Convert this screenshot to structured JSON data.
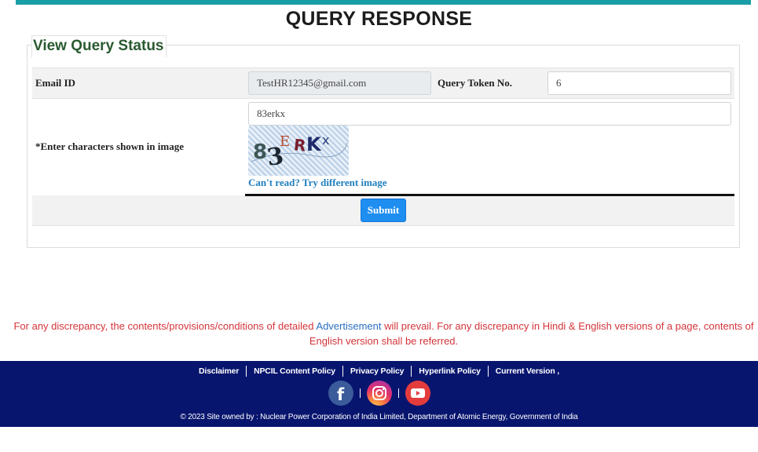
{
  "page": {
    "title": "QUERY RESPONSE",
    "accent_color": "#1a9ea6"
  },
  "form": {
    "legend": "View Query Status",
    "email_label": "Email ID",
    "email_value": "TestHR12345@gmail.com",
    "token_label": "Query Token No.",
    "token_value": "6",
    "captcha_label": "*Enter characters shown in image",
    "captcha_value": "83erkx",
    "captcha_chars": [
      "8",
      "3",
      "E",
      "R",
      "K",
      "x"
    ],
    "captcha_refresh_link": "Can't read? Try different image",
    "submit_label": "Submit",
    "submit_color": "#1f8ef1"
  },
  "notice": {
    "part1": "For any discrepancy, the contents/provisions/conditions of detailed ",
    "link": "Advertisement",
    "part2": " will prevail. For any discrepancy in Hindi & English versions of a page, contents of English version shall be referred.",
    "color": "#d4343a"
  },
  "footer": {
    "background": "#07156e",
    "links": [
      "Disclaimer",
      "NPCIL Content Policy",
      "Privacy Policy",
      "Hyperlink Policy",
      "Current Version ,"
    ],
    "social": [
      "facebook-icon",
      "instagram-icon",
      "youtube-icon"
    ],
    "copyright": "© 2023 Site owned by : Nuclear Power Corporation of India Limited, Department of Atomic Energy, Government of India"
  }
}
